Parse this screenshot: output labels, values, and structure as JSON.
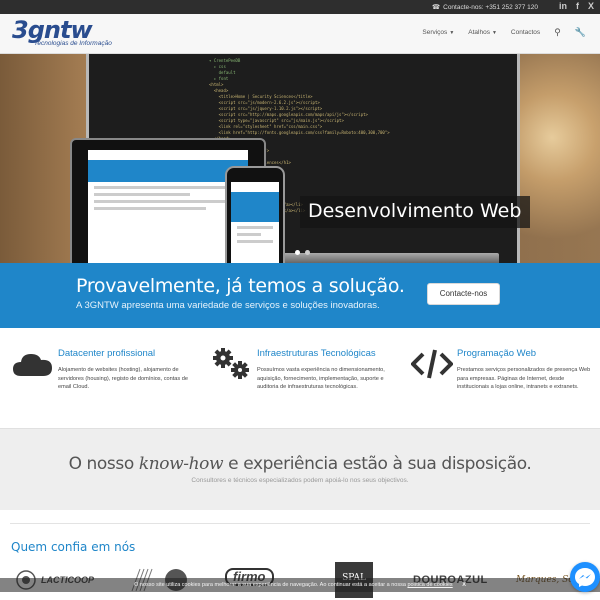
{
  "topbar": {
    "contact_text": "Contacte-nos: +351 252 377 120",
    "social": [
      "in",
      "f",
      "X"
    ]
  },
  "header": {
    "logo_mark": "3gntw",
    "logo_tagline": "Tecnologias de Informação",
    "nav": [
      {
        "label": "Serviços",
        "dropdown": true
      },
      {
        "label": "Atalhos",
        "dropdown": true
      },
      {
        "label": "Contactos",
        "dropdown": false
      }
    ]
  },
  "hero": {
    "caption": "Desenvolvimento Web",
    "slides": 2,
    "active_slide": 1
  },
  "band": {
    "title": "Provavelmente, já temos a solução.",
    "subtitle": "A 3GNTW apresenta uma variedade de serviços e soluções inovadoras.",
    "button_label": "Contacte-nos"
  },
  "features": [
    {
      "icon": "cloud-icon",
      "title": "Datacenter profissional",
      "text": "Alojamento de websites (hosting), alojamento de servidores (housing), registo de domínios, contas de email Cloud."
    },
    {
      "icon": "gears-icon",
      "title": "Infraestruturas Tecnológicas",
      "text": "Possuímos vasta experiência no dimensionamento, aquisição, fornecimento, implementação, suporte e auditoria de infraestruturas tecnológicas."
    },
    {
      "icon": "code-icon",
      "title": "Programação Web",
      "text": "Prestamos serviços personalizados de presença Web para empresas. Páginas de Internet, desde institucionais a lojas online, intranets e extranets."
    }
  ],
  "knowhow": {
    "title_before": "O nosso ",
    "title_em": "know-how",
    "title_after": " e experiência estão à sua disposição.",
    "subtitle": "Consultores e técnicos especializados podem apoiá-lo nos seus objectivos."
  },
  "clients": {
    "title": "Quem confia em nós",
    "logos": [
      "LACTICOOP",
      "firmo",
      "SPAL",
      "DOUROAZUL",
      "Marques, Soares"
    ]
  },
  "cookie": {
    "text": "O nosso site utiliza cookies para melhorar a sua experiência de navegação. Ao continuar está a aceitar a nossa",
    "link": "política de cookies",
    "close": "X"
  },
  "colors": {
    "brand_blue": "#1f86c9",
    "logo_blue": "#2a4d8f",
    "topbar": "#2e2e2e"
  }
}
